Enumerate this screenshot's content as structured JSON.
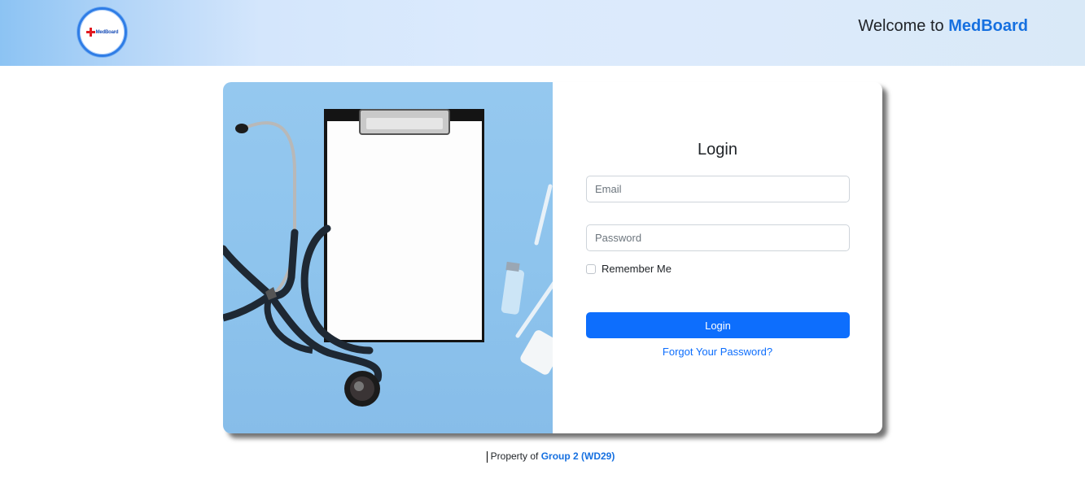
{
  "header": {
    "logo_text": "MedBoard",
    "welcome_prefix": "Welcome to",
    "brand": "MedBoard"
  },
  "login": {
    "title": "Login",
    "email_placeholder": "Email",
    "password_placeholder": "Password",
    "remember_label": "Remember Me",
    "remember_checked": false,
    "button_label": "Login",
    "forgot_label": "Forgot Your Password?"
  },
  "footer": {
    "prefix": "Property of",
    "group": "Group 2 (WD29)"
  },
  "colors": {
    "accent": "#0d6efd",
    "brand": "#1670e0",
    "photo_bg": "#8ec4ed"
  }
}
